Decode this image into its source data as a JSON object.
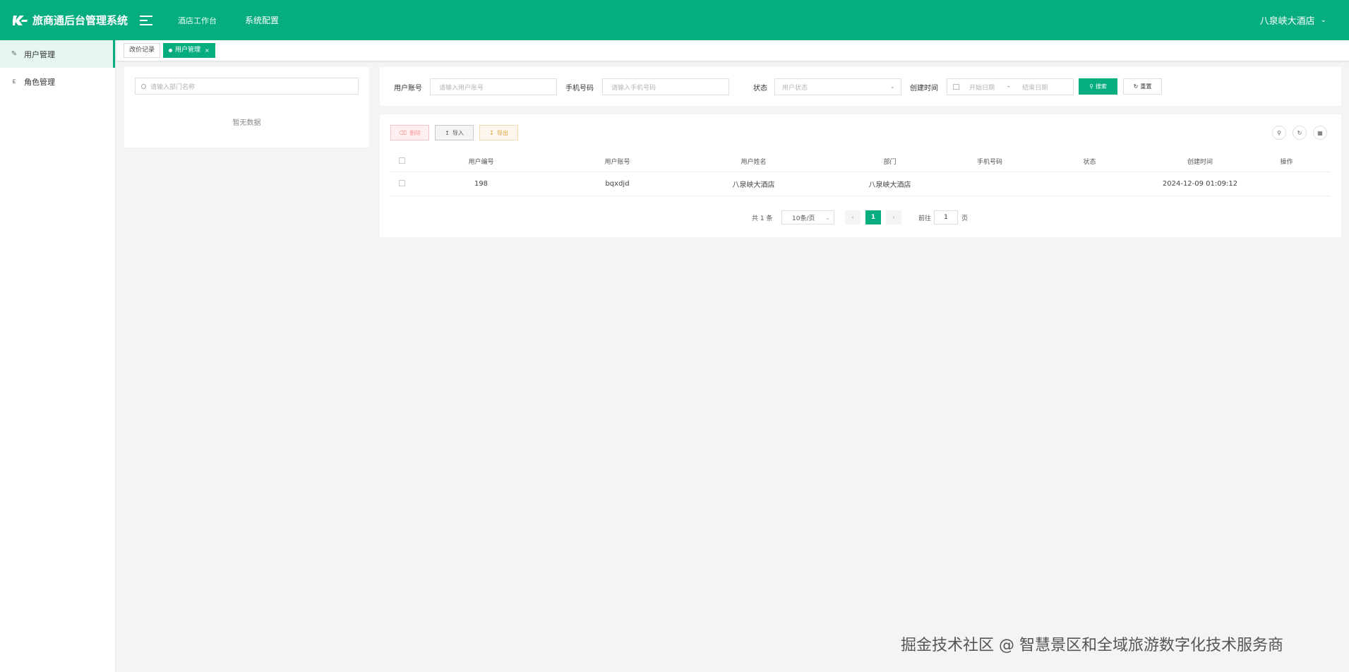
{
  "header": {
    "title": "旅商通后台管理系统",
    "nav": [
      "酒店工作台",
      "系统配置"
    ],
    "user": "八泉峡大酒店"
  },
  "sidebar": {
    "items": [
      {
        "label": "用户管理",
        "active": true
      },
      {
        "label": "角色管理",
        "active": false
      }
    ]
  },
  "tabs": [
    {
      "label": "改价记录",
      "active": false
    },
    {
      "label": "用户管理",
      "active": true,
      "close": "×"
    }
  ],
  "dept": {
    "search_placeholder": "请输入部门名称",
    "empty_text": "暂无数据"
  },
  "search_form": {
    "account_label": "用户账号",
    "account_placeholder": "请输入用户账号",
    "phone_label": "手机号码",
    "phone_placeholder": "请输入手机号码",
    "status_label": "状态",
    "status_placeholder": "用户状态",
    "created_label": "创建时间",
    "start_placeholder": "开始日期",
    "date_sep": "-",
    "end_placeholder": "结束日期",
    "search_button": "搜索",
    "reset_button": "重置"
  },
  "toolbar": {
    "delete": "删除",
    "import": "导入",
    "export": "导出"
  },
  "table": {
    "columns": [
      "用户编号",
      "用户账号",
      "用户姓名",
      "部门",
      "手机号码",
      "状态",
      "创建时间",
      "操作"
    ],
    "rows": [
      {
        "id": "198",
        "account": "bqxdjd",
        "name": "八泉峡大酒店",
        "dept": "八泉峡大酒店",
        "phone": "",
        "status": "",
        "created": "2024-12-09 01:09:12",
        "ops": ""
      }
    ]
  },
  "pagination": {
    "total": "共 1 条",
    "page_size": "10条/页",
    "current": "1",
    "goto_label": "前往",
    "goto_value": "1",
    "page_suffix": "页"
  },
  "watermark": "掘金技术社区 @ 智慧景区和全域旅游数字化技术服务商",
  "colors": {
    "primary": "#06ad7f"
  }
}
